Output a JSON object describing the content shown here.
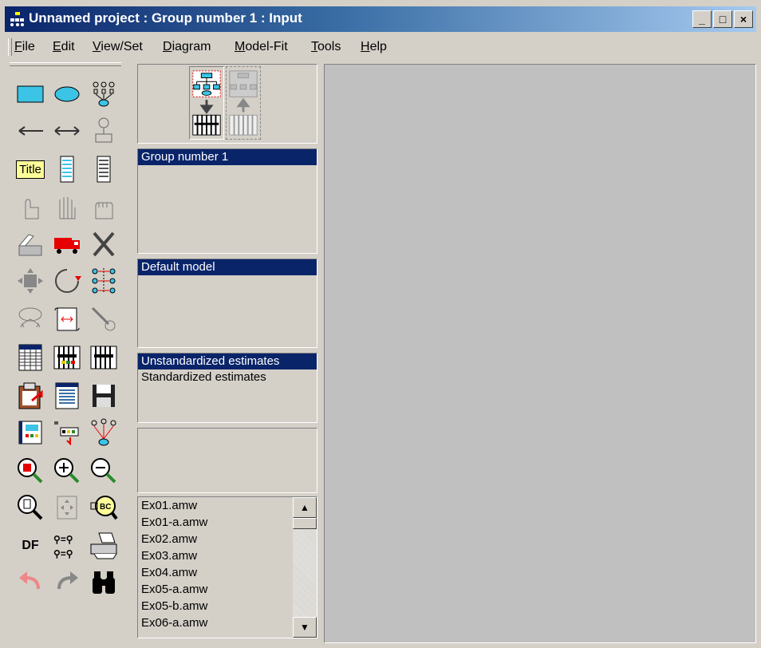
{
  "window": {
    "title": "Unnamed project : Group number 1 : Input",
    "minimize": "_",
    "maximize": "□",
    "close": "×"
  },
  "menu": {
    "items": [
      {
        "acc": "F",
        "rest": "ile"
      },
      {
        "acc": "E",
        "rest": "dit"
      },
      {
        "acc": "V",
        "rest": "iew/Set"
      },
      {
        "acc": "D",
        "rest": "iagram"
      },
      {
        "acc": "M",
        "rest": "odel-Fit"
      },
      {
        "acc": "T",
        "rest": "ools"
      },
      {
        "acc": "H",
        "rest": "elp"
      }
    ]
  },
  "toolbox": {
    "title_tool": "Title",
    "df_tool": "DF"
  },
  "groups": {
    "items": [
      "Group number 1"
    ],
    "selected": 0
  },
  "models": {
    "items": [
      "Default model"
    ],
    "selected": 0
  },
  "estimates": {
    "items": [
      "Unstandardized estimates",
      "Standardized estimates"
    ],
    "selected": 0
  },
  "files": {
    "items": [
      "Ex01.amw",
      "Ex01-a.amw",
      "Ex02.amw",
      "Ex03.amw",
      "Ex04.amw",
      "Ex05-a.amw",
      "Ex05-b.amw",
      "Ex06-a.amw"
    ]
  },
  "colors": {
    "selection": "#0a246a",
    "face": "#d4d0c8",
    "canvas": "#c0c0c0"
  }
}
